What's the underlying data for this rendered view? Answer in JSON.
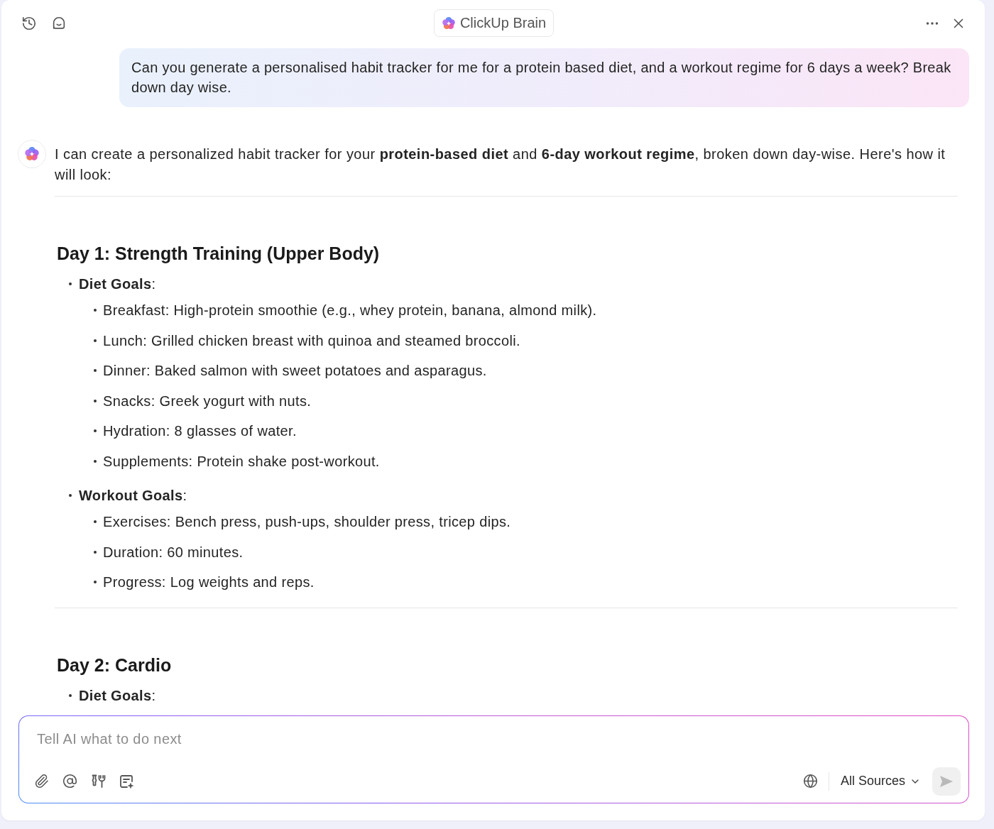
{
  "header": {
    "title": "ClickUp Brain"
  },
  "user_message": {
    "text": "Can you generate a personalised habit tracker for me for a protein based diet, and a workout regime for 6 days a week? Break down day wise."
  },
  "assistant_message": {
    "intro": "I can create a personalized habit tracker for your **protein-based diet** and **6-day workout regime**, broken down day-wise. Here's how it will look:",
    "days": [
      {
        "title": "Day 1: Strength Training (Upper Body)",
        "sections": [
          {
            "label": "**Diet Goals**:",
            "items": [
              "Breakfast: High-protein smoothie (e.g., whey protein, banana, almond milk).",
              "Lunch: Grilled chicken breast with quinoa and steamed broccoli.",
              "Dinner: Baked salmon with sweet potatoes and asparagus.",
              "Snacks: Greek yogurt with nuts.",
              "Hydration: 8 glasses of water.",
              "Supplements: Protein shake post-workout."
            ]
          },
          {
            "label": "**Workout Goals**:",
            "items": [
              "Exercises: Bench press, push-ups, shoulder press, tricep dips.",
              "Duration: 60 minutes.",
              "Progress: Log weights and reps."
            ]
          }
        ]
      },
      {
        "title": "Day 2: Cardio",
        "sections": [
          {
            "label": "**Diet Goals**:"
          }
        ]
      }
    ]
  },
  "composer": {
    "placeholder": "Tell AI what to do next",
    "sources": "All Sources",
    "send": {
      "disabled": true
    }
  }
}
